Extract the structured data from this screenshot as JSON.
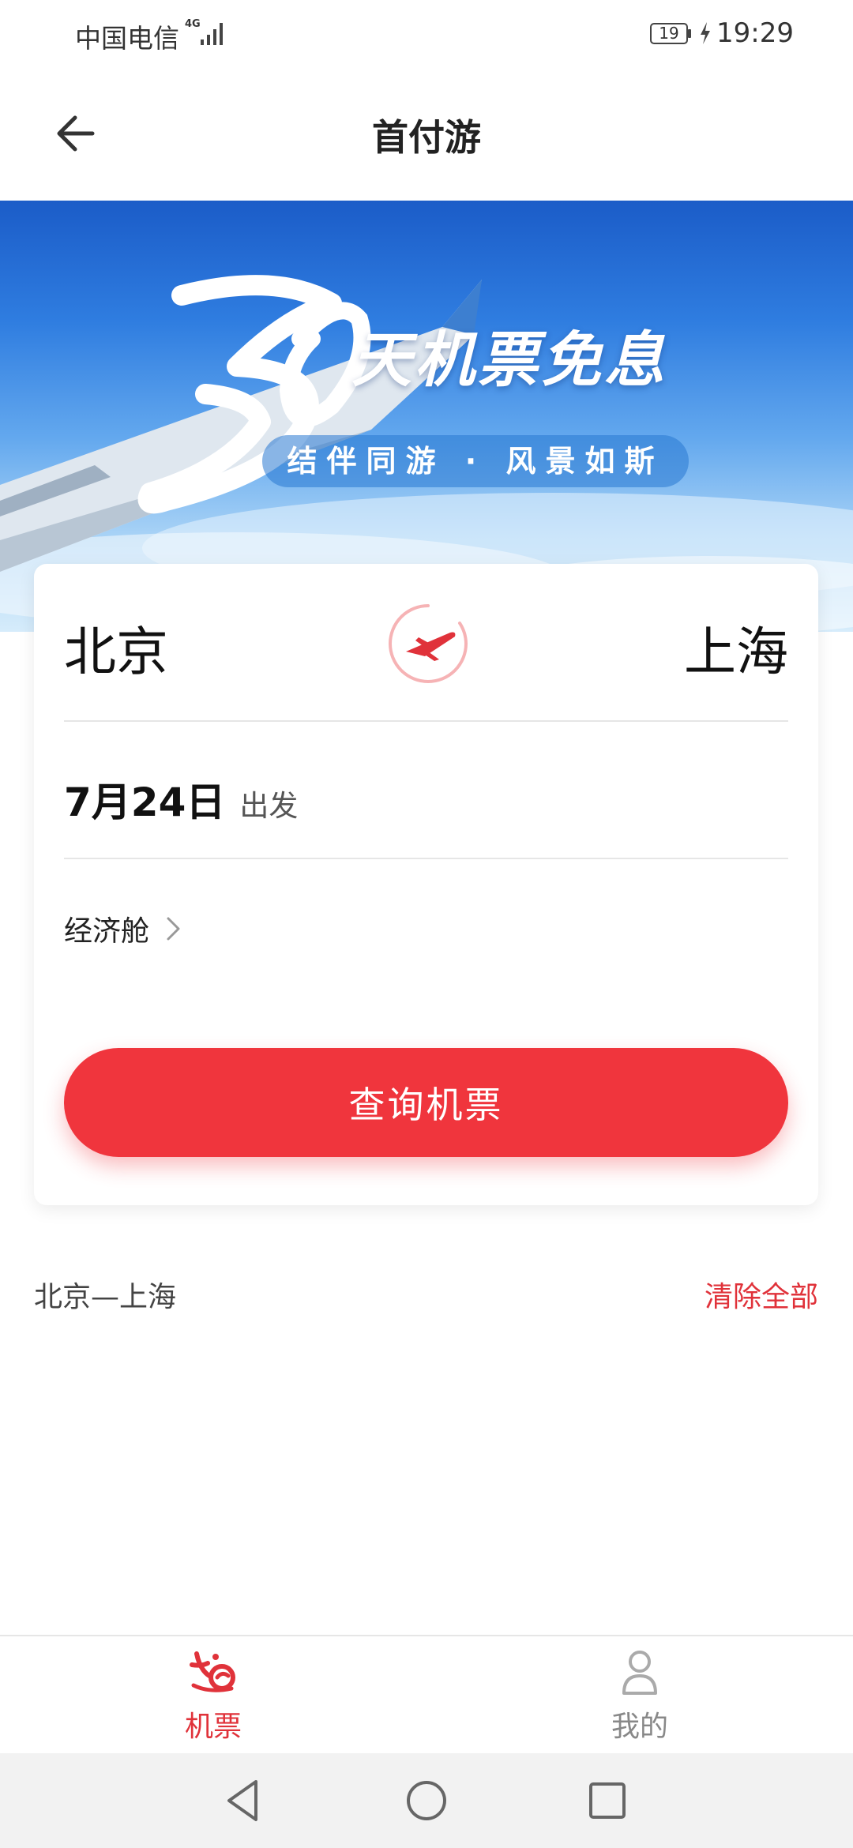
{
  "status_bar": {
    "carrier": "中国电信",
    "network": "4G",
    "battery": "19",
    "time": "19:29"
  },
  "header": {
    "title": "首付游"
  },
  "banner": {
    "number": "30",
    "headline": "天机票免息",
    "subline": "结伴同游 · 风景如斯"
  },
  "search": {
    "from_city": "北京",
    "to_city": "上海",
    "date": "7月24日",
    "date_suffix": "出发",
    "cabin": "经济舱",
    "submit_label": "查询机票"
  },
  "history": {
    "items": [
      "北京—上海"
    ],
    "clear_label": "清除全部"
  },
  "bottom_nav": {
    "tabs": [
      {
        "label": "机票",
        "icon": "flight-logo-icon",
        "active": true
      },
      {
        "label": "我的",
        "icon": "user-icon",
        "active": false
      }
    ]
  },
  "colors": {
    "accent": "#f0353d",
    "banner_blue": "#2f7de0"
  }
}
